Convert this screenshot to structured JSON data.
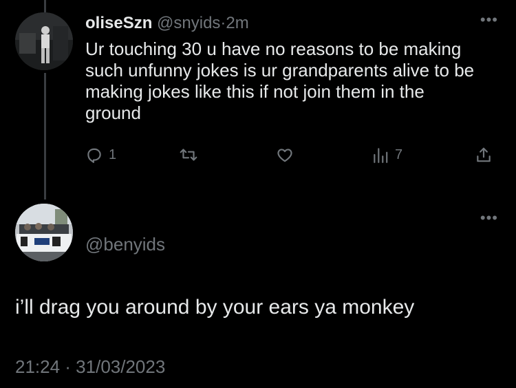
{
  "reply": {
    "display_name": "oliseSzn",
    "handle": "@snyids",
    "separator": "·",
    "time_ago": "2m",
    "text": "Ur touching 30 u have no reasons to be making such unfunny jokes is ur grandparents alive to be making jokes like this if not join them in the ground",
    "reply_count": "1",
    "view_count": "7",
    "more_label": "•••"
  },
  "main_tweet": {
    "handle": "@benyids",
    "text": "i’ll drag you around by your ears ya monkey",
    "timestamp": "21:24 · 31/03/2023",
    "more_label": "•••"
  },
  "icons": {
    "reply": "speech-bubble-icon",
    "retweet": "retweet-icon",
    "like": "heart-icon",
    "views": "bar-chart-icon",
    "share": "share-icon"
  },
  "colors": {
    "background": "#000000",
    "text": "#e7e9ea",
    "muted": "#71767b"
  }
}
